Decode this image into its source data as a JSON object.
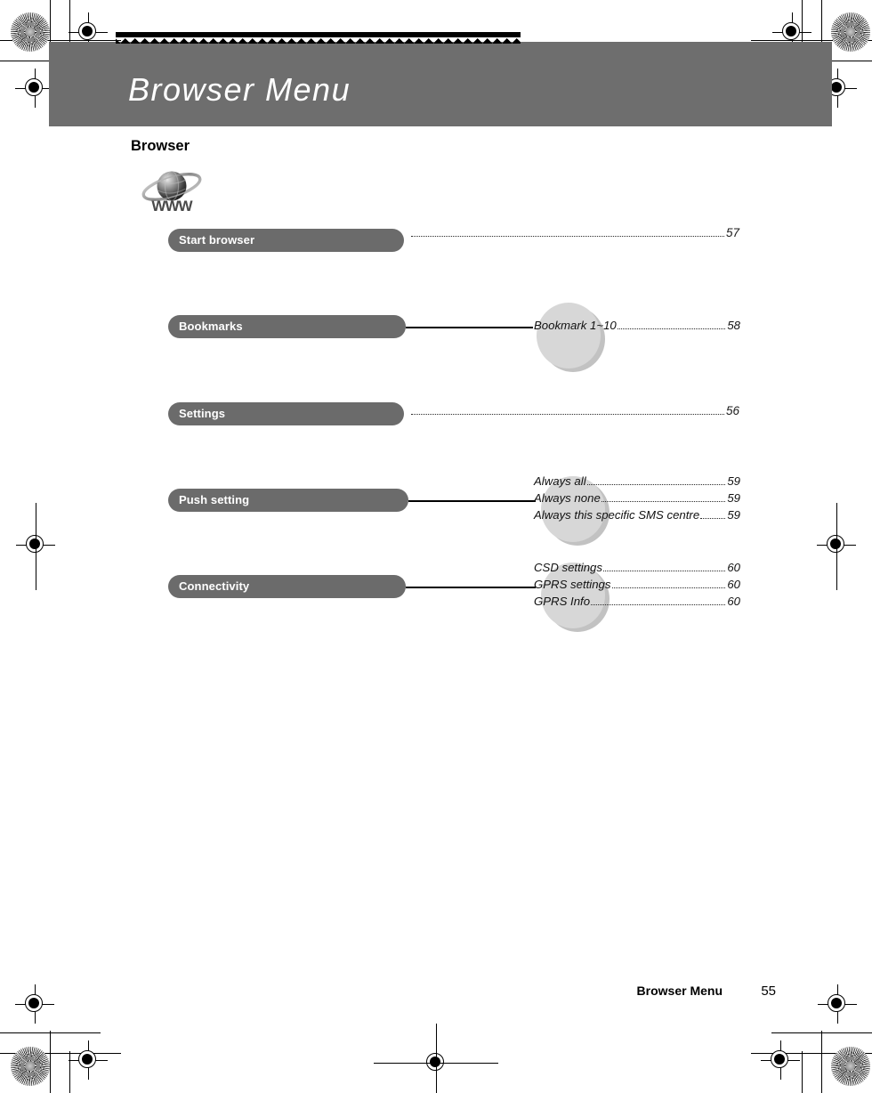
{
  "header": {
    "title": "Browser Menu",
    "banner_color": "#6e6e6e"
  },
  "section": {
    "heading": "Browser",
    "icon": "www-globe-icon",
    "icon_label": "WWW"
  },
  "menu": {
    "items": [
      {
        "label": "Start browser",
        "type": "leader",
        "page": "57"
      },
      {
        "label": "Bookmarks",
        "type": "branch",
        "entries": [
          {
            "label": "Bookmark 1~10",
            "page": "58"
          }
        ]
      },
      {
        "label": "Settings",
        "type": "leader",
        "page": "56"
      },
      {
        "label": "Push setting",
        "type": "branch",
        "entries": [
          {
            "label": "Always all",
            "page": "59"
          },
          {
            "label": "Always none",
            "page": "59"
          },
          {
            "label": "Always this specific SMS centre",
            "page": "59"
          }
        ]
      },
      {
        "label": "Connectivity",
        "type": "branch",
        "entries": [
          {
            "label": "CSD settings",
            "page": "60"
          },
          {
            "label": "GPRS settings",
            "page": "60"
          },
          {
            "label": "GPRS Info",
            "page": "60"
          }
        ]
      }
    ]
  },
  "footer": {
    "title": "Browser Menu",
    "page": "55"
  },
  "colors": {
    "pill": "#6b6b6b",
    "bubble": "#d7d7d7",
    "banner": "#6e6e6e"
  }
}
